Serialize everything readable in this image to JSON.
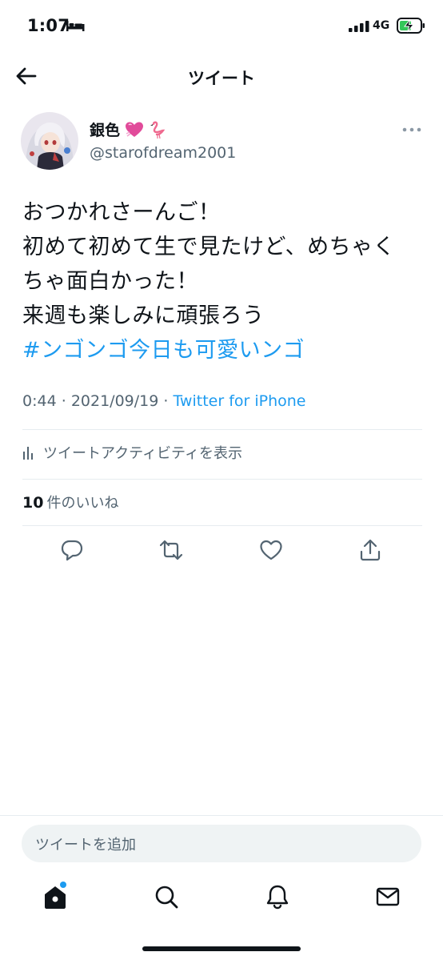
{
  "status_bar": {
    "time": "1:07",
    "network": "4G",
    "icons": [
      "bed-icon",
      "signal-icon",
      "battery-charging-icon"
    ]
  },
  "header": {
    "title": "ツイート",
    "back_icon": "arrow-left-icon"
  },
  "tweet": {
    "author": {
      "display_name": "銀色",
      "emojis": [
        "heart-emoji",
        "flamingo-emoji"
      ],
      "handle": "@starofdream2001"
    },
    "lines": [
      "おつかれさーんご！",
      "初めて初めて生で見たけど、めちゃく",
      "ちゃ面白かった！",
      "来週も楽しみに頑張ろう"
    ],
    "hashtag": "#ンゴンゴ今日も可愛いンゴ",
    "time": "0:44",
    "date": "2021/09/19",
    "separator": "·",
    "source": "Twitter for iPhone",
    "activity_label": "ツイートアクティビティを表示",
    "likes_count": "10",
    "likes_label": "件のいいね"
  },
  "actions": [
    "reply-icon",
    "retweet-icon",
    "like-icon",
    "share-icon"
  ],
  "compose": {
    "placeholder": "ツイートを追加"
  },
  "tab_bar": [
    "home-icon",
    "search-icon",
    "notifications-icon",
    "messages-icon"
  ],
  "colors": {
    "accent": "#1d9bf0",
    "text": "#0f1419",
    "secondary": "#536471",
    "divider": "#e6ecf0",
    "input_bg": "#eff3f4"
  }
}
